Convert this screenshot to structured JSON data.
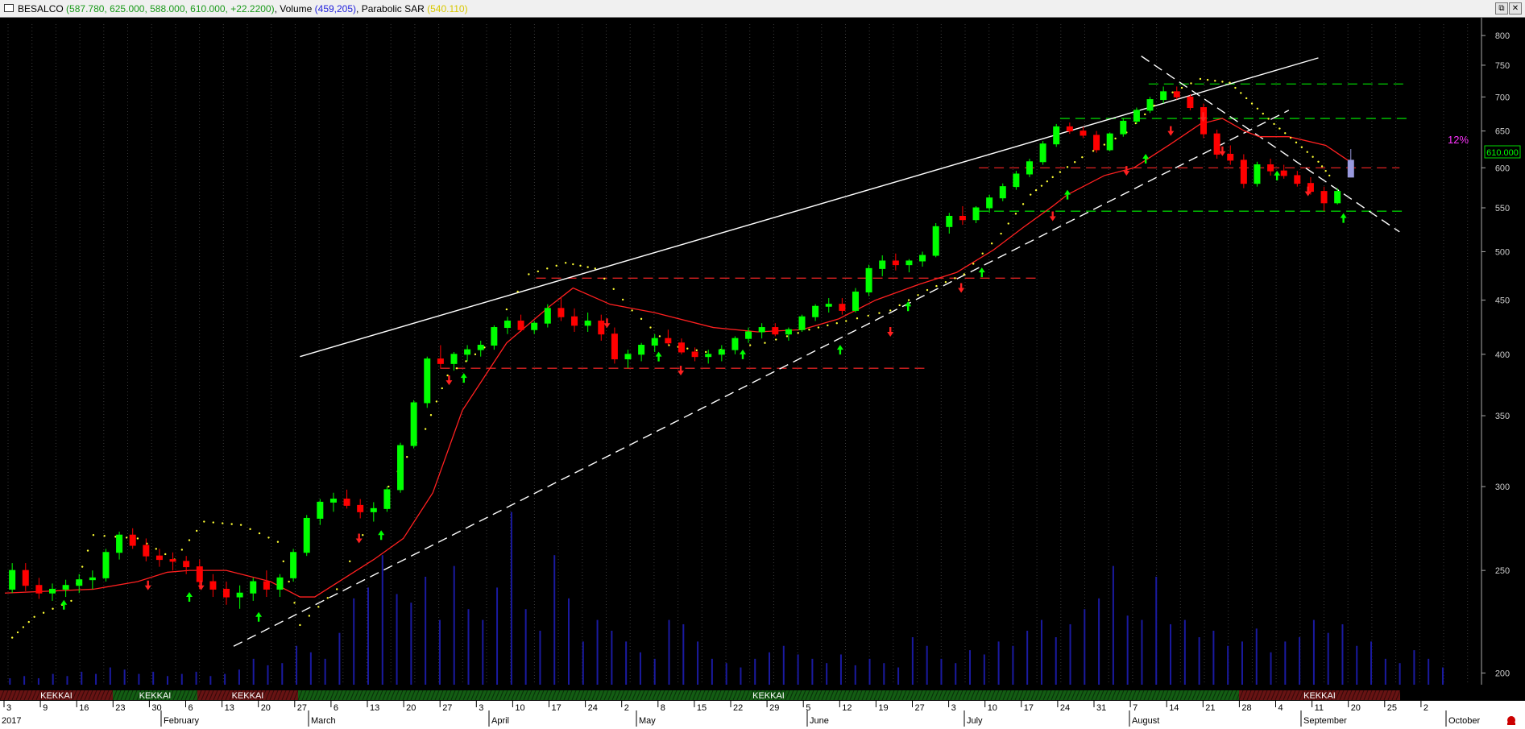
{
  "window": {
    "symbol": "BESALCO",
    "ohlc_text": "(587.780, 625.000, 588.000, 610.000, +22.2200)",
    "volume_label": "Volume",
    "volume_text": "(459,205)",
    "sar_label": "Parabolic SAR",
    "sar_text": "(540.110)",
    "restore_glyph": "⧉",
    "close_glyph": "✕"
  },
  "colors": {
    "up_candle": "#00ff00",
    "down_candle": "#ff0000",
    "neutral_candle": "#9999dd",
    "moving_average": "#ff2020",
    "sar_dots": "#ffff33",
    "volume_bars": "#1a1aa0",
    "trendline_solid": "#ffffff",
    "support_green": "#00cc00",
    "resistance_red": "#dd2222",
    "percent_label": "#ff33ff",
    "up_arrow": "#00ff00",
    "down_arrow": "#ff2020",
    "band_green": "#22aa22",
    "band_red": "#bb2222"
  },
  "annotations": {
    "percent_label": "12%",
    "last_price_tag": "610.000"
  },
  "bands": [
    {
      "label": "KEKKAI",
      "type": "red"
    },
    {
      "label": "KEKKAI",
      "type": "green"
    },
    {
      "label": "KEKKAI",
      "type": "red"
    },
    {
      "label": "KEKKAI",
      "type": "green"
    },
    {
      "label": "KEKKAI",
      "type": "red"
    }
  ],
  "chart_data": {
    "type": "candlestick",
    "scale": "log",
    "ylim": [
      195,
      820
    ],
    "y_ticks": [
      800,
      750,
      700,
      650,
      600,
      550,
      500,
      450,
      400,
      350,
      300,
      250,
      200
    ],
    "x_tick_labels": [
      "3",
      "9",
      "16",
      "23",
      "30",
      "6",
      "13",
      "20",
      "27",
      "6",
      "13",
      "20",
      "27",
      "3",
      "10",
      "17",
      "24",
      "2",
      "8",
      "15",
      "22",
      "29",
      "5",
      "12",
      "19",
      "27",
      "3",
      "10",
      "17",
      "24",
      "31",
      "7",
      "14",
      "21",
      "28",
      "4",
      "11",
      "20",
      "25",
      "2"
    ],
    "month_labels": [
      "2017",
      "February",
      "March",
      "April",
      "May",
      "June",
      "July",
      "August",
      "September",
      "October"
    ],
    "candles": [
      [
        240,
        254,
        238,
        250
      ],
      [
        250,
        254,
        239,
        242
      ],
      [
        242,
        246,
        235,
        238
      ],
      [
        238,
        243,
        234,
        240
      ],
      [
        240,
        245,
        236,
        242
      ],
      [
        242,
        248,
        238,
        245
      ],
      [
        245,
        250,
        240,
        246
      ],
      [
        246,
        262,
        244,
        260
      ],
      [
        260,
        272,
        256,
        270
      ],
      [
        270,
        274,
        262,
        264
      ],
      [
        264,
        268,
        255,
        258
      ],
      [
        258,
        262,
        252,
        256
      ],
      [
        256,
        260,
        250,
        255
      ],
      [
        255,
        258,
        248,
        252
      ],
      [
        252,
        256,
        240,
        244
      ],
      [
        244,
        248,
        236,
        240
      ],
      [
        240,
        244,
        232,
        236
      ],
      [
        236,
        242,
        230,
        238
      ],
      [
        238,
        246,
        234,
        244
      ],
      [
        244,
        250,
        236,
        240
      ],
      [
        240,
        248,
        236,
        246
      ],
      [
        246,
        262,
        244,
        260
      ],
      [
        260,
        282,
        258,
        280
      ],
      [
        280,
        292,
        276,
        290
      ],
      [
        290,
        296,
        284,
        292
      ],
      [
        292,
        298,
        286,
        288
      ],
      [
        288,
        292,
        280,
        284
      ],
      [
        284,
        290,
        278,
        286
      ],
      [
        286,
        300,
        284,
        298
      ],
      [
        298,
        330,
        296,
        328
      ],
      [
        328,
        362,
        326,
        360
      ],
      [
        360,
        398,
        356,
        396
      ],
      [
        396,
        408,
        388,
        392
      ],
      [
        392,
        402,
        386,
        400
      ],
      [
        400,
        408,
        394,
        404
      ],
      [
        404,
        412,
        398,
        408
      ],
      [
        408,
        426,
        404,
        424
      ],
      [
        424,
        434,
        418,
        430
      ],
      [
        430,
        436,
        420,
        422
      ],
      [
        422,
        430,
        418,
        428
      ],
      [
        428,
        446,
        424,
        442
      ],
      [
        442,
        452,
        430,
        434
      ],
      [
        434,
        442,
        420,
        426
      ],
      [
        426,
        438,
        420,
        430
      ],
      [
        430,
        436,
        412,
        418
      ],
      [
        418,
        424,
        392,
        396
      ],
      [
        396,
        404,
        388,
        400
      ],
      [
        400,
        410,
        394,
        408
      ],
      [
        408,
        418,
        402,
        414
      ],
      [
        414,
        422,
        408,
        410
      ],
      [
        410,
        414,
        400,
        402
      ],
      [
        402,
        406,
        394,
        398
      ],
      [
        398,
        404,
        392,
        400
      ],
      [
        400,
        408,
        394,
        404
      ],
      [
        404,
        416,
        400,
        414
      ],
      [
        414,
        424,
        410,
        420
      ],
      [
        420,
        428,
        414,
        424
      ],
      [
        424,
        428,
        416,
        418
      ],
      [
        418,
        424,
        412,
        422
      ],
      [
        422,
        436,
        420,
        434
      ],
      [
        434,
        446,
        430,
        444
      ],
      [
        444,
        452,
        438,
        446
      ],
      [
        446,
        452,
        436,
        440
      ],
      [
        440,
        462,
        438,
        458
      ],
      [
        458,
        486,
        454,
        482
      ],
      [
        482,
        496,
        474,
        490
      ],
      [
        490,
        498,
        480,
        486
      ],
      [
        486,
        492,
        478,
        490
      ],
      [
        490,
        500,
        484,
        496
      ],
      [
        496,
        532,
        494,
        528
      ],
      [
        528,
        544,
        520,
        540
      ],
      [
        540,
        552,
        530,
        536
      ],
      [
        536,
        552,
        532,
        550
      ],
      [
        550,
        566,
        544,
        562
      ],
      [
        562,
        580,
        558,
        576
      ],
      [
        576,
        596,
        572,
        592
      ],
      [
        592,
        612,
        588,
        608
      ],
      [
        608,
        636,
        604,
        632
      ],
      [
        632,
        660,
        628,
        656
      ],
      [
        656,
        662,
        646,
        650
      ],
      [
        650,
        656,
        640,
        644
      ],
      [
        644,
        650,
        620,
        624
      ],
      [
        624,
        648,
        622,
        646
      ],
      [
        646,
        668,
        642,
        664
      ],
      [
        664,
        684,
        660,
        680
      ],
      [
        680,
        700,
        676,
        696
      ],
      [
        696,
        716,
        690,
        708
      ],
      [
        708,
        716,
        696,
        700
      ],
      [
        700,
        704,
        680,
        684
      ],
      [
        684,
        690,
        640,
        646
      ],
      [
        646,
        652,
        612,
        618
      ],
      [
        618,
        630,
        604,
        610
      ],
      [
        610,
        618,
        574,
        580
      ],
      [
        580,
        608,
        576,
        604
      ],
      [
        604,
        612,
        590,
        596
      ],
      [
        596,
        604,
        586,
        590
      ],
      [
        590,
        596,
        576,
        580
      ],
      [
        580,
        588,
        566,
        570
      ],
      [
        570,
        576,
        546,
        556
      ],
      [
        556,
        574,
        554,
        570
      ],
      [
        588,
        625,
        588,
        610
      ]
    ],
    "sma": [
      [
        0,
        238
      ],
      [
        0.06,
        240
      ],
      [
        0.09,
        244
      ],
      [
        0.11,
        249
      ],
      [
        0.125,
        250
      ],
      [
        0.15,
        250
      ],
      [
        0.18,
        244
      ],
      [
        0.2,
        236
      ],
      [
        0.21,
        236
      ],
      [
        0.25,
        256
      ],
      [
        0.27,
        268
      ],
      [
        0.29,
        296
      ],
      [
        0.31,
        354
      ],
      [
        0.34,
        410
      ],
      [
        0.37,
        445
      ],
      [
        0.385,
        462
      ],
      [
        0.41,
        446
      ],
      [
        0.44,
        438
      ],
      [
        0.48,
        424
      ],
      [
        0.51,
        420
      ],
      [
        0.54,
        422
      ],
      [
        0.565,
        432
      ],
      [
        0.59,
        450
      ],
      [
        0.62,
        466
      ],
      [
        0.645,
        478
      ],
      [
        0.67,
        502
      ],
      [
        0.69,
        527
      ],
      [
        0.71,
        552
      ],
      [
        0.72,
        566
      ],
      [
        0.745,
        590
      ],
      [
        0.765,
        600
      ],
      [
        0.79,
        632
      ],
      [
        0.81,
        660
      ],
      [
        0.825,
        668
      ],
      [
        0.84,
        650
      ],
      [
        0.85,
        642
      ],
      [
        0.87,
        642
      ],
      [
        0.895,
        630
      ],
      [
        0.91,
        610
      ]
    ],
    "sar": [
      [
        0.005,
        216
      ],
      [
        0.02,
        226
      ],
      [
        0.045,
        234
      ],
      [
        0.06,
        270
      ],
      [
        0.09,
        268
      ],
      [
        0.115,
        256
      ],
      [
        0.135,
        278
      ],
      [
        0.16,
        276
      ],
      [
        0.185,
        266
      ],
      [
        0.2,
        222
      ],
      [
        0.225,
        240
      ],
      [
        0.26,
        300
      ],
      [
        0.285,
        340
      ],
      [
        0.3,
        382
      ],
      [
        0.325,
        406
      ],
      [
        0.355,
        476
      ],
      [
        0.38,
        488
      ],
      [
        0.4,
        482
      ],
      [
        0.425,
        440
      ],
      [
        0.45,
        408
      ],
      [
        0.475,
        402
      ],
      [
        0.515,
        410
      ],
      [
        0.545,
        422
      ],
      [
        0.57,
        430
      ],
      [
        0.6,
        440
      ],
      [
        0.625,
        460
      ],
      [
        0.65,
        476
      ],
      [
        0.675,
        520
      ],
      [
        0.695,
        566
      ],
      [
        0.71,
        588
      ],
      [
        0.73,
        614
      ],
      [
        0.76,
        648
      ],
      [
        0.785,
        700
      ],
      [
        0.81,
        728
      ],
      [
        0.83,
        722
      ],
      [
        0.845,
        690
      ],
      [
        0.86,
        660
      ],
      [
        0.875,
        634
      ],
      [
        0.89,
        608
      ],
      [
        0.9,
        584
      ]
    ],
    "volume": [
      0.03,
      0.04,
      0.03,
      0.05,
      0.04,
      0.06,
      0.05,
      0.08,
      0.07,
      0.05,
      0.06,
      0.04,
      0.05,
      0.06,
      0.04,
      0.05,
      0.07,
      0.12,
      0.09,
      0.1,
      0.18,
      0.15,
      0.12,
      0.24,
      0.4,
      0.45,
      0.6,
      0.42,
      0.38,
      0.5,
      0.3,
      0.55,
      0.35,
      0.3,
      0.45,
      0.8,
      0.35,
      0.25,
      0.6,
      0.4,
      0.2,
      0.3,
      0.25,
      0.2,
      0.15,
      0.12,
      0.3,
      0.28,
      0.2,
      0.12,
      0.1,
      0.08,
      0.12,
      0.15,
      0.18,
      0.14,
      0.12,
      0.1,
      0.14,
      0.09,
      0.12,
      0.1,
      0.08,
      0.22,
      0.18,
      0.12,
      0.1,
      0.16,
      0.14,
      0.2,
      0.18,
      0.25,
      0.3,
      0.22,
      0.28,
      0.35,
      0.4,
      0.55,
      0.32,
      0.3,
      0.5,
      0.28,
      0.3,
      0.22,
      0.25,
      0.18,
      0.2,
      0.26,
      0.15,
      0.2,
      0.22,
      0.3,
      0.24,
      0.28,
      0.18,
      0.2,
      0.12,
      0.1,
      0.16,
      0.12,
      0.08
    ],
    "trendlines": [
      {
        "style": "solid",
        "from": [
          0.2,
          398
        ],
        "to": [
          0.89,
          762
        ]
      },
      {
        "style": "dashed",
        "from": [
          0.155,
          212
        ],
        "to": [
          0.87,
          680
        ]
      },
      {
        "style": "dashed",
        "from": [
          0.77,
          765
        ],
        "to": [
          0.945,
          522
        ]
      }
    ],
    "horizontal_levels": [
      {
        "color": "green",
        "value": 720,
        "from": 0.775,
        "to": 0.95
      },
      {
        "color": "green",
        "value": 668,
        "from": 0.715,
        "to": 0.95
      },
      {
        "color": "green",
        "value": 546,
        "from": 0.66,
        "to": 0.95
      },
      {
        "color": "red",
        "value": 600,
        "from": 0.66,
        "to": 0.945
      },
      {
        "color": "red",
        "value": 472,
        "from": 0.36,
        "to": 0.7
      },
      {
        "color": "red",
        "value": 388,
        "from": 0.295,
        "to": 0.625
      }
    ],
    "arrows": [
      {
        "dir": "up",
        "x": 0.04,
        "value": 232
      },
      {
        "dir": "down",
        "x": 0.097,
        "value": 242
      },
      {
        "dir": "up",
        "x": 0.125,
        "value": 236
      },
      {
        "dir": "down",
        "x": 0.133,
        "value": 242
      },
      {
        "dir": "up",
        "x": 0.172,
        "value": 226
      },
      {
        "dir": "down",
        "x": 0.24,
        "value": 268
      },
      {
        "dir": "up",
        "x": 0.255,
        "value": 270
      },
      {
        "dir": "down",
        "x": 0.301,
        "value": 378
      },
      {
        "dir": "up",
        "x": 0.311,
        "value": 380
      },
      {
        "dir": "down",
        "x": 0.408,
        "value": 428
      },
      {
        "dir": "up",
        "x": 0.443,
        "value": 398
      },
      {
        "dir": "down",
        "x": 0.458,
        "value": 386
      },
      {
        "dir": "up",
        "x": 0.5,
        "value": 400
      },
      {
        "dir": "up",
        "x": 0.566,
        "value": 404
      },
      {
        "dir": "down",
        "x": 0.6,
        "value": 420
      },
      {
        "dir": "up",
        "x": 0.612,
        "value": 444
      },
      {
        "dir": "down",
        "x": 0.648,
        "value": 462
      },
      {
        "dir": "up",
        "x": 0.662,
        "value": 478
      },
      {
        "dir": "down",
        "x": 0.71,
        "value": 540
      },
      {
        "dir": "up",
        "x": 0.72,
        "value": 566
      },
      {
        "dir": "down",
        "x": 0.76,
        "value": 596
      },
      {
        "dir": "up",
        "x": 0.773,
        "value": 612
      },
      {
        "dir": "down",
        "x": 0.79,
        "value": 650
      },
      {
        "dir": "down",
        "x": 0.812,
        "value": 670
      },
      {
        "dir": "down",
        "x": 0.825,
        "value": 622
      },
      {
        "dir": "up",
        "x": 0.862,
        "value": 590
      },
      {
        "dir": "down",
        "x": 0.883,
        "value": 570
      },
      {
        "dir": "up",
        "x": 0.907,
        "value": 538
      }
    ]
  }
}
